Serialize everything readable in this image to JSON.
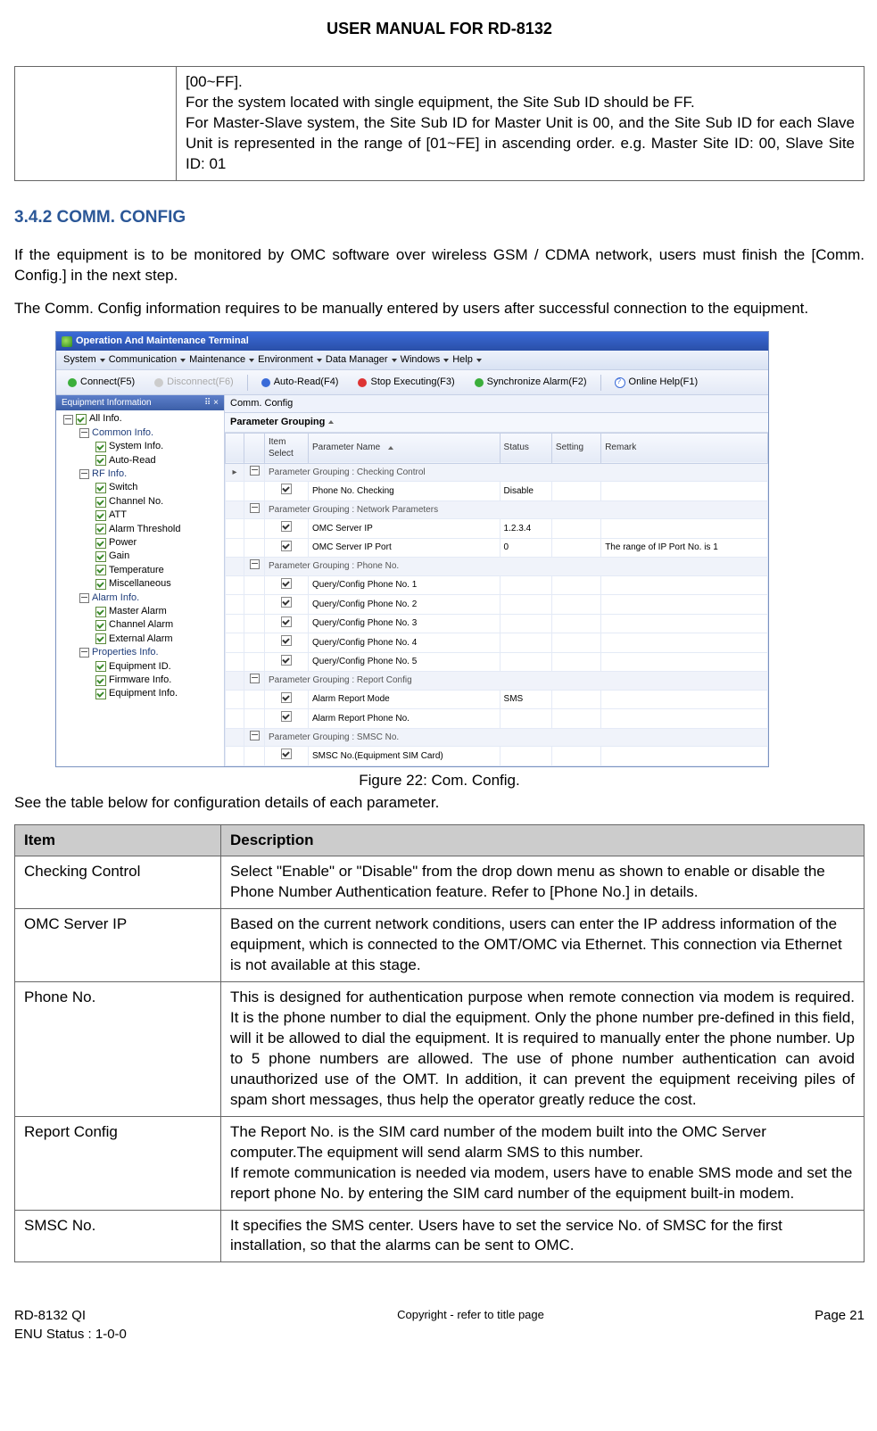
{
  "header": {
    "title": "USER MANUAL FOR RD-8132"
  },
  "top_table": {
    "cell": "[00~FF].\nFor the system located with single equipment, the Site Sub ID should be FF.\nFor Master-Slave system, the Site Sub ID for Master Unit is 00, and the Site Sub ID for each Slave Unit is represented in the range of [01~FE] in ascending order. e.g. Master Site ID: 00, Slave Site ID: 01"
  },
  "section": {
    "number_title": "3.4.2  COMM. CONFIG",
    "p1": "If the equipment is to be monitored by OMC software over wireless GSM / CDMA network, users must finish the [Comm. Config.] in the next step.",
    "p2": "The Comm. Config information requires to be manually entered by users after successful connection to the equipment."
  },
  "figure": {
    "window_title": "Operation And Maintenance Terminal",
    "menus": [
      "System",
      "Communication",
      "Maintenance",
      "Environment",
      "Data Manager",
      "Windows",
      "Help"
    ],
    "toolbar": {
      "connect": "Connect(F5)",
      "disconnect": "Disconnect(F6)",
      "autoread": "Auto-Read(F4)",
      "stop": "Stop Executing(F3)",
      "sync": "Synchronize Alarm(F2)",
      "help": "Online Help(F1)"
    },
    "sidebar_title": "Equipment Information",
    "sidebar_pin": "⠿ ×",
    "tree": {
      "all": "All Info.",
      "common": "Common Info.",
      "system_info": "System Info.",
      "auto_read": "Auto-Read",
      "rf": "RF Info.",
      "switch": "Switch",
      "channel": "Channel No.",
      "att": "ATT",
      "alarm_thr": "Alarm Threshold",
      "power": "Power",
      "gain": "Gain",
      "temp": "Temperature",
      "misc": "Miscellaneous",
      "alarm_info": "Alarm Info.",
      "master_alarm": "Master Alarm",
      "channel_alarm": "Channel Alarm",
      "external_alarm": "External Alarm",
      "props": "Properties Info.",
      "equip_id": "Equipment ID.",
      "firmware": "Firmware Info.",
      "equip_info": "Equipment Info."
    },
    "tab": "Comm. Config",
    "group_hdr": "Parameter Grouping",
    "columns": [
      "Item Select",
      "Parameter Name",
      "Status",
      "Setting",
      "Remark"
    ],
    "groups": {
      "checking": "Parameter Grouping : Checking Control",
      "network": "Parameter Grouping : Network Parameters",
      "phone": "Parameter Grouping : Phone No.",
      "report": "Parameter Grouping : Report Config",
      "smsc": "Parameter Grouping : SMSC No."
    },
    "rows": {
      "phone_check": {
        "name": "Phone No. Checking",
        "status": "Disable"
      },
      "omc_ip": {
        "name": "OMC Server IP",
        "status": "1.2.3.4"
      },
      "omc_port": {
        "name": "OMC Server IP Port",
        "status": "0",
        "remark": "The range of IP Port No. is 1"
      },
      "q1": "Query/Config Phone No. 1",
      "q2": "Query/Config Phone No. 2",
      "q3": "Query/Config Phone No. 3",
      "q4": "Query/Config Phone No. 4",
      "q5": "Query/Config Phone No. 5",
      "alarm_mode": {
        "name": "Alarm Report Mode",
        "status": "SMS"
      },
      "alarm_phone": "Alarm Report Phone No.",
      "smsc_no": "SMSC No.(Equipment SIM Card)"
    },
    "caption": "Figure 22: Com. Config.",
    "after": "See the table below for configuration details of each parameter."
  },
  "param_table": {
    "head_item": "Item",
    "head_desc": "Description",
    "rows": [
      {
        "item": "Checking Control",
        "desc": "Select \"Enable\" or \"Disable\" from the drop down menu as shown to enable or disable the Phone Number Authentication feature. Refer to [Phone No.] in details."
      },
      {
        "item": "OMC Server IP",
        "desc": "Based on the current network conditions, users can enter the IP address information of the equipment, which is connected to the OMT/OMC via Ethernet. This connection via Ethernet is not available at this stage."
      },
      {
        "item": "Phone No.",
        "desc": "This is designed for authentication purpose when remote connection via modem is required. It is the phone number to dial the equipment. Only the phone number pre-defined in this field, will it be allowed to dial the equipment. It is required to manually enter the phone number. Up to 5 phone numbers are allowed. The use of phone number authentication can avoid unauthorized use of the OMT. In addition, it can prevent the equipment receiving piles of spam short messages, thus help the operator greatly reduce the cost."
      },
      {
        "item": "Report Config",
        "desc": "The Report No. is the SIM card number of the modem built into the OMC Server computer.The equipment will send alarm SMS to this number.\nIf remote communication is needed via modem, users have to enable SMS mode and set the report phone No. by entering the SIM card number of the equipment built-in modem."
      },
      {
        "item": "SMSC No.",
        "desc": "It specifies the SMS center. Users have to set the service No. of SMSC for the first installation, so that the alarms can be sent to OMC."
      }
    ]
  },
  "footer": {
    "left1": "RD-8132 QI",
    "left2": "ENU Status : 1-0-0",
    "center": "Copyright - refer to title page",
    "right": "Page 21"
  }
}
